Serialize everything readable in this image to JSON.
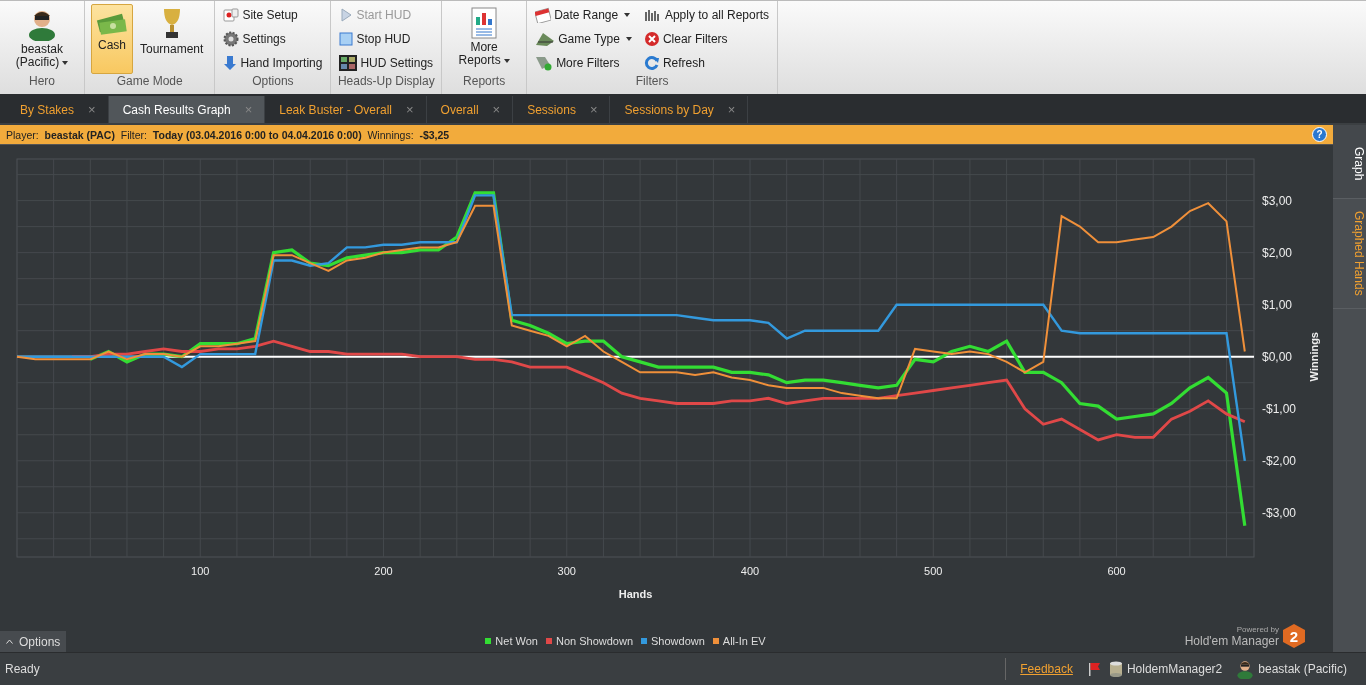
{
  "ribbon": {
    "groups": [
      {
        "label": "Hero",
        "kind": "hero",
        "items": [
          {
            "label": "beastak (Pacific)",
            "dropdown": true
          }
        ]
      },
      {
        "label": "Game Mode",
        "kind": "large",
        "items": [
          {
            "label": "Cash",
            "selected": true
          },
          {
            "label": "Tournament",
            "selected": false
          }
        ]
      },
      {
        "label": "Options",
        "kind": "small",
        "items": [
          {
            "label": "Site Setup",
            "disabled": false,
            "dropdown": false
          },
          {
            "label": "Settings",
            "disabled": false,
            "dropdown": false
          },
          {
            "label": "Hand Importing",
            "disabled": false,
            "dropdown": false
          }
        ]
      },
      {
        "label": "Heads-Up Display",
        "kind": "small",
        "items": [
          {
            "label": "Start HUD",
            "disabled": true,
            "dropdown": false
          },
          {
            "label": "Stop HUD",
            "disabled": false,
            "dropdown": false
          },
          {
            "label": "HUD Settings",
            "disabled": false,
            "dropdown": false
          }
        ]
      },
      {
        "label": "Reports",
        "kind": "hero",
        "items": [
          {
            "label": "More Reports",
            "dropdown": true
          }
        ]
      },
      {
        "label": "Filters",
        "kind": "small",
        "items": [
          {
            "label": "Date Range",
            "disabled": false,
            "dropdown": true
          },
          {
            "label": "Game Type",
            "disabled": false,
            "dropdown": true
          },
          {
            "label": "More Filters",
            "disabled": false,
            "dropdown": false
          },
          {
            "label": "Apply to all Reports",
            "disabled": false,
            "dropdown": false
          },
          {
            "label": "Clear Filters",
            "disabled": false,
            "dropdown": false
          },
          {
            "label": "Refresh",
            "disabled": false,
            "dropdown": false
          }
        ]
      }
    ]
  },
  "tabs": [
    {
      "label": "By Stakes",
      "selected": false,
      "close": "×"
    },
    {
      "label": "Cash Results Graph",
      "selected": true,
      "close": "×"
    },
    {
      "label": "Leak Buster - Overall",
      "selected": false,
      "close": "×"
    },
    {
      "label": "Overall",
      "selected": false,
      "close": "×"
    },
    {
      "label": "Sessions",
      "selected": false,
      "close": "×"
    },
    {
      "label": "Sessions by Day",
      "selected": false,
      "close": "×"
    }
  ],
  "info_bar": {
    "text": "Player:  **beastak (PAC)**  Filter:  **Today (03.04.2016 0:00 to 04.04.2016 0:00)**  Winnings:  **-$3,25**",
    "help": "?"
  },
  "side_tabs": [
    {
      "label": "Graph",
      "selected": true
    },
    {
      "label": "Graphed Hands",
      "selected": false
    }
  ],
  "chart": {
    "chart_data": {
      "type": "line",
      "grid": true,
      "xlabel": "Hands",
      "ylabel": "Winnings",
      "xlim": [
        0,
        675
      ],
      "ylim": [
        -3.85,
        3.8
      ],
      "xticks": [
        100,
        200,
        300,
        400,
        500,
        600
      ],
      "yticks": [
        {
          "value": 3,
          "label": "$3,00"
        },
        {
          "value": 2,
          "label": "$2,00"
        },
        {
          "value": 1,
          "label": "$1,00"
        },
        {
          "value": 0,
          "label": "$0,00"
        },
        {
          "value": -1,
          "label": "-$1,00"
        },
        {
          "value": -2,
          "label": "-$2,00"
        },
        {
          "value": -3,
          "label": "-$3,00"
        }
      ],
      "x": [
        0,
        10,
        20,
        30,
        40,
        50,
        60,
        70,
        80,
        90,
        100,
        110,
        120,
        130,
        140,
        150,
        160,
        170,
        180,
        190,
        200,
        210,
        220,
        230,
        240,
        250,
        260,
        270,
        280,
        290,
        300,
        310,
        320,
        330,
        340,
        350,
        360,
        370,
        380,
        390,
        400,
        410,
        420,
        430,
        440,
        450,
        460,
        470,
        480,
        490,
        500,
        510,
        520,
        530,
        540,
        550,
        560,
        570,
        580,
        590,
        600,
        610,
        620,
        630,
        640,
        650,
        660,
        670
      ],
      "series": [
        {
          "name": "Net Won",
          "color": "#33dd33",
          "values": [
            null,
            null,
            null,
            null,
            -0.05,
            0.1,
            -0.1,
            0.05,
            0.05,
            0,
            0.25,
            0.25,
            0.25,
            0.35,
            2.0,
            2.05,
            1.8,
            1.75,
            1.9,
            1.95,
            2.0,
            2.0,
            2.05,
            2.05,
            2.3,
            3.15,
            3.15,
            0.7,
            0.6,
            0.45,
            0.25,
            0.3,
            0.3,
            0,
            -0.1,
            -0.2,
            -0.2,
            -0.2,
            -0.2,
            -0.3,
            -0.3,
            -0.35,
            -0.5,
            -0.45,
            -0.45,
            -0.5,
            -0.55,
            -0.6,
            -0.55,
            -0.05,
            -0.1,
            0.1,
            0.2,
            0.1,
            0.3,
            -0.3,
            -0.3,
            -0.5,
            -0.9,
            -0.95,
            -1.2,
            -1.15,
            -1.1,
            -0.9,
            -0.6,
            -0.4,
            -0.7,
            -3.25
          ]
        },
        {
          "name": "Non Showdown",
          "color": "#e04848",
          "values": [
            null,
            null,
            null,
            0,
            0,
            0.05,
            0.05,
            0.1,
            0.15,
            0.1,
            0.1,
            0.15,
            0.15,
            0.2,
            0.3,
            0.2,
            0.1,
            0.1,
            0.05,
            0.05,
            0.05,
            0.05,
            0,
            0,
            0,
            -0.05,
            -0.05,
            -0.1,
            -0.2,
            -0.2,
            -0.2,
            -0.35,
            -0.5,
            -0.7,
            -0.8,
            -0.85,
            -0.9,
            -0.9,
            -0.9,
            -0.85,
            -0.85,
            -0.8,
            -0.9,
            -0.85,
            -0.8,
            -0.8,
            -0.8,
            -0.8,
            -0.75,
            -0.7,
            -0.65,
            -0.6,
            -0.55,
            -0.5,
            -0.45,
            -1.0,
            -1.3,
            -1.2,
            -1.4,
            -1.6,
            -1.5,
            -1.55,
            -1.55,
            -1.2,
            -1.05,
            -0.85,
            -1.1,
            -1.25
          ]
        },
        {
          "name": "Showdown",
          "color": "#3399dd",
          "values": [
            0,
            0,
            0,
            0,
            0,
            0,
            0,
            0,
            0,
            -0.2,
            0.05,
            0.05,
            0.05,
            0.05,
            1.85,
            1.85,
            1.75,
            1.8,
            2.1,
            2.1,
            2.15,
            2.15,
            2.2,
            2.2,
            2.2,
            3.1,
            3.1,
            0.8,
            0.8,
            0.8,
            0.8,
            0.8,
            0.8,
            0.8,
            0.8,
            0.8,
            0.8,
            0.75,
            0.7,
            0.7,
            0.7,
            0.65,
            0.35,
            0.5,
            0.5,
            0.5,
            0.5,
            0.5,
            1.0,
            1.0,
            1.0,
            1.0,
            1.0,
            1.0,
            1.0,
            1.0,
            1.0,
            0.5,
            0.45,
            0.45,
            0.45,
            0.45,
            0.45,
            0.45,
            0.45,
            0.45,
            0.45,
            -2.0
          ]
        },
        {
          "name": "All-In EV",
          "color": "#f0903a",
          "values": [
            0,
            -0.05,
            -0.05,
            -0.05,
            -0.05,
            0.1,
            -0.05,
            0.05,
            0.05,
            0,
            0.2,
            0.2,
            0.25,
            0.3,
            1.95,
            1.95,
            1.8,
            1.65,
            1.85,
            1.9,
            2.0,
            2.05,
            2.1,
            2.1,
            2.2,
            2.9,
            2.9,
            0.6,
            0.5,
            0.4,
            0.2,
            0.4,
            0.1,
            -0.1,
            -0.3,
            -0.3,
            -0.3,
            -0.35,
            -0.3,
            -0.4,
            -0.45,
            -0.55,
            -0.6,
            -0.6,
            -0.6,
            -0.7,
            -0.75,
            -0.8,
            -0.8,
            0.15,
            0.1,
            0.05,
            0.1,
            0.05,
            -0.1,
            -0.3,
            -0.1,
            2.7,
            2.5,
            2.2,
            2.2,
            2.25,
            2.3,
            2.5,
            2.8,
            2.95,
            2.6,
            0.1
          ]
        }
      ]
    }
  },
  "options_button": "Options",
  "branding": {
    "powered_by": "Powered by",
    "product": "Hold'em Manager",
    "logo": "2"
  },
  "status_bar": {
    "status": "Ready",
    "feedback": "Feedback",
    "database": "HoldemManager2",
    "player": "beastak (Pacific)"
  }
}
